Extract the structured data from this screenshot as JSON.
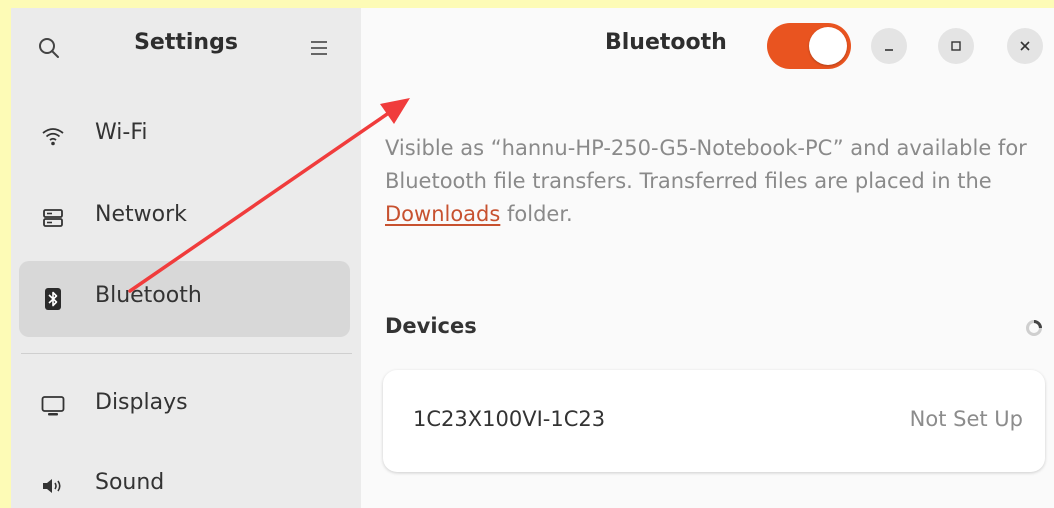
{
  "sidebar": {
    "title": "Settings",
    "search_icon": "search-icon",
    "menu_icon": "hamburger-menu-icon",
    "items": [
      {
        "label": "Wi-Fi",
        "icon": "wifi-icon"
      },
      {
        "label": "Network",
        "icon": "network-icon"
      },
      {
        "label": "Bluetooth",
        "icon": "bluetooth-icon",
        "selected": true
      },
      {
        "label": "Displays",
        "icon": "display-icon"
      },
      {
        "label": "Sound",
        "icon": "speaker-icon"
      }
    ]
  },
  "header": {
    "title": "Bluetooth",
    "toggle_state": "on"
  },
  "info": {
    "text_before": "Visible as “hannu-HP-250-G5-Notebook-PC” and available for Bluetooth file transfers. Transferred files are placed in the ",
    "link": "Downloads",
    "text_after": " folder."
  },
  "devices": {
    "title": "Devices",
    "list": [
      {
        "name": "1C23X100VI-1C23",
        "status": "Not Set Up"
      }
    ]
  },
  "colors": {
    "accent": "#e95420",
    "link": "#c7512f",
    "annotation_arrow": "#f03c3c",
    "highlight_bar": "#fdfbb6"
  }
}
